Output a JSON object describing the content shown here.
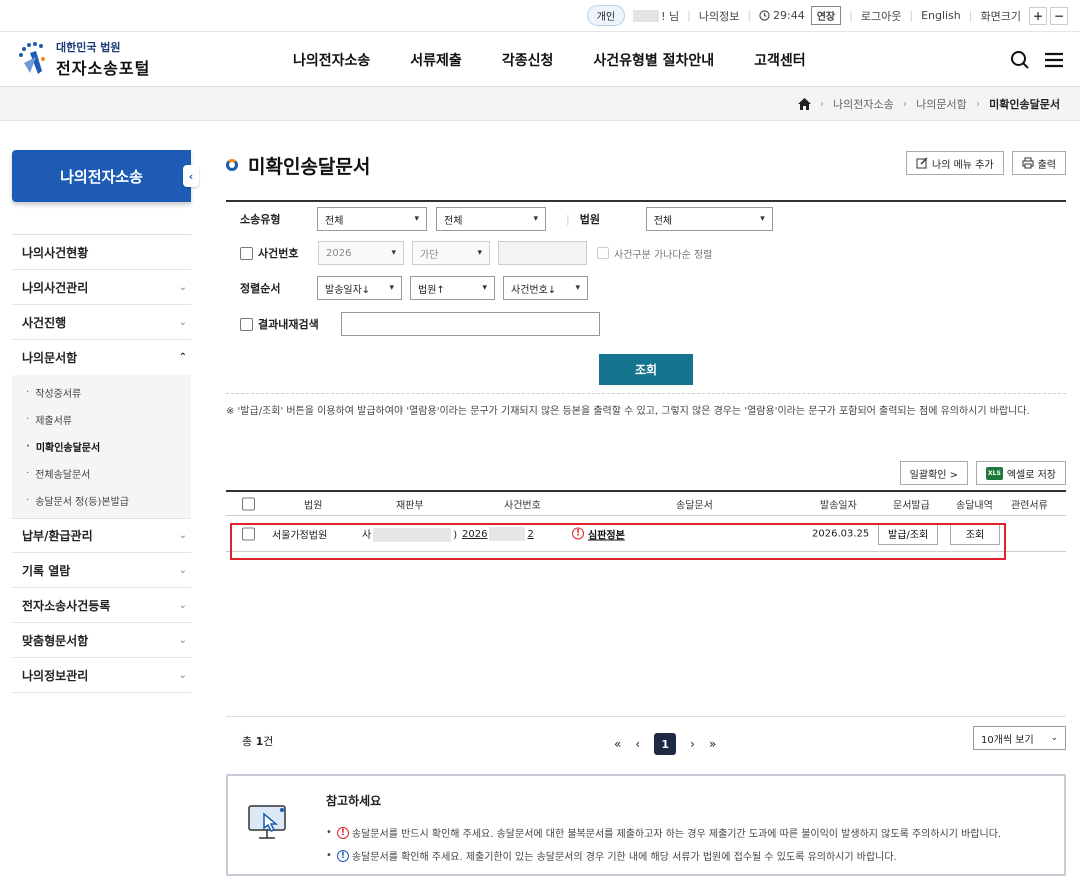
{
  "util": {
    "type_pill": "개인",
    "user_suffix": "! 님",
    "my_info": "나의정보",
    "timer": "29:44",
    "extend": "연장",
    "logout": "로그아웃",
    "english": "English",
    "screen_size": "화면크기",
    "zoom_in": "+",
    "zoom_out": "−"
  },
  "logo": {
    "line1": "대한민국 법원",
    "line2": "전자소송포털"
  },
  "gnb": [
    "나의전자소송",
    "서류제출",
    "각종신청",
    "사건유형별 절차안내",
    "고객센터"
  ],
  "breadcrumb": [
    "나의전자소송",
    "나의문서함",
    "미확인송달문서"
  ],
  "sidebar": {
    "title": "나의전자소송",
    "items": [
      {
        "label": "나의사건현황",
        "arrow": ""
      },
      {
        "label": "나의사건관리",
        "arrow": "⌄"
      },
      {
        "label": "사건진행",
        "arrow": "⌄"
      },
      {
        "label": "나의문서함",
        "arrow": "⌃"
      }
    ],
    "sub_items": [
      "작성중서류",
      "제출서류",
      "미확인송달문서",
      "전체송달문서",
      "송달문서 정(등)본발급"
    ],
    "items_after": [
      {
        "label": "납부/환급관리",
        "arrow": "⌄"
      },
      {
        "label": "기록 열람",
        "arrow": "⌄"
      },
      {
        "label": "전자소송사건등록",
        "arrow": "⌄"
      },
      {
        "label": "맞춤형문서함",
        "arrow": "⌄"
      },
      {
        "label": "나의정보관리",
        "arrow": "⌄"
      }
    ]
  },
  "page": {
    "title": "미확인송달문서",
    "add_menu": "나의 메뉴 추가",
    "print": "출력"
  },
  "search": {
    "suit_type_label": "소송유형",
    "suit_type_1": "전체",
    "suit_type_2": "전체",
    "court_label": "법원",
    "court": "전체",
    "case_no_label": "사건번호",
    "year": "2026",
    "case_kind": "가단",
    "sort_check_label": "사건구분 가나다순 정렬",
    "order_label": "정렬순서",
    "order_1": "발송일자↓",
    "order_2": "법원↑",
    "order_3": "사건번호↓",
    "result_search_label": "결과내재검색",
    "query_button": "조회"
  },
  "note": "※ '발급/조회' 버튼을 이용하여 발급하여야 '열람용'이라는 문구가 기재되지 않은 등본을 출력할 수 있고, 그렇지 않은 경우는 '열람용'이라는 문구가 포함되어 출력되는 점에 유의하시기 바랍니다.",
  "table_tools": {
    "bulk_confirm": "일괄확인 >",
    "excel": "엑셀로 저장",
    "xls_badge": "XLS"
  },
  "table": {
    "headers": [
      "법원",
      "재판부",
      "사건번호",
      "송달문서",
      "발송일자",
      "문서발급",
      "송달내역",
      "관련서류"
    ],
    "rows": [
      {
        "court": "서울가정법원",
        "division_prefix": "사",
        "division_suffix": ")",
        "case_prefix": "2026",
        "case_suffix": "2",
        "document": "심판정본",
        "sent_date": "2026.03.25",
        "issue_button": "발급/조회",
        "history_button": "조회"
      }
    ]
  },
  "pagination": {
    "total_label": "총",
    "total_count": "1",
    "total_unit": "건",
    "first": "«",
    "prev": "‹",
    "current": "1",
    "next": "›",
    "last": "»",
    "per_page": "10개씩 보기"
  },
  "reference": {
    "title": "참고하세요",
    "items": [
      "송달문서를 반드시 확인해 주세요. 송달문서에 대한 불복문서를 제출하고자 하는 경우 제출기간 도과에 따른 불이익이 발생하지 않도록 주의하시기 바랍니다.",
      "송달문서를 확인해 주세요. 제출기한이 있는 송달문서의 경우 기한 내에 해당 서류가 법원에 접수될 수 있도록 유의하시기 바랍니다."
    ]
  },
  "colors": {
    "primary": "#1e5bb5",
    "query": "#13768e",
    "highlight": "#e0232d",
    "pager_active": "#1d2a44"
  }
}
